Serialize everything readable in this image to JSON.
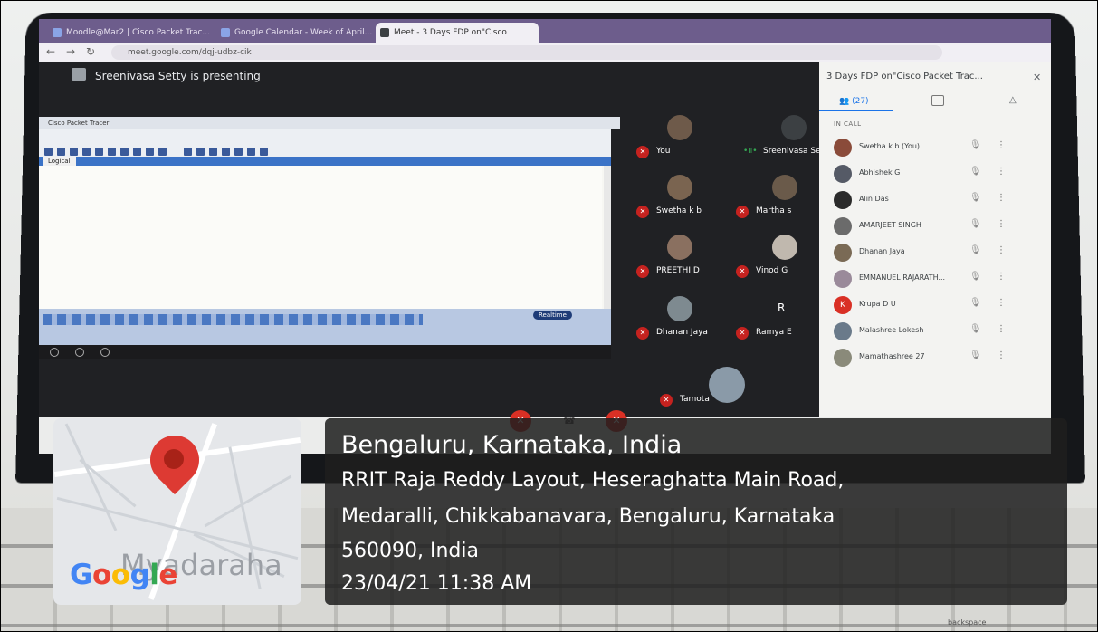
{
  "browser": {
    "tabs": [
      "Moodle@Mar2 | Cisco Packet Trac...",
      "Google Calendar - Week of April...",
      "Meet - 3 Days FDP on\"Cisco"
    ],
    "url": "meet.google.com/dqj-udbz-cik"
  },
  "meet": {
    "presenting_text": "Sreenivasa Setty is presenting",
    "panel_title": "3 Days FDP on\"Cisco Packet Trac...",
    "people_count": "(27)",
    "in_call_label": "IN CALL",
    "participants": [
      {
        "name": "Swetha k b (You)",
        "color": "#8a4b3a"
      },
      {
        "name": "Abhishek G",
        "color": "#555a66"
      },
      {
        "name": "Alin Das",
        "color": "#2b2b2b"
      },
      {
        "name": "AMARJEET SINGH",
        "color": "#6b6b6b"
      },
      {
        "name": "Dhanan Jaya",
        "color": "#7a6a55"
      },
      {
        "name": "EMMANUEL RAJARATH...",
        "color": "#9a8a9a"
      },
      {
        "name": "Krupa D U",
        "color": "#d93025",
        "initial": "K"
      },
      {
        "name": "Malashree Lokesh",
        "color": "#6a7a8a"
      },
      {
        "name": "Mamathashree 27",
        "color": "#8a8a7a"
      }
    ],
    "tiles": [
      {
        "name": "You"
      },
      {
        "name": "Sreenivasa Setty"
      },
      {
        "name": "Swetha k b"
      },
      {
        "name": "Martha s"
      },
      {
        "name": "PREETHI D"
      },
      {
        "name": "Vinod G"
      },
      {
        "name": "Dhanan Jaya"
      },
      {
        "name": "Ramya E",
        "initial": "R"
      },
      {
        "name": "Tamota"
      }
    ],
    "pt_window_title": "Cisco Packet Tracer",
    "pt_tab": "Logical",
    "pt_realtime": "Realtime"
  },
  "location": {
    "city": "Bengaluru, Karnataka, India",
    "address_line1": "RRIT Raja Reddy Layout, Heseraghatta Main Road,",
    "address_line2": "Medaralli, Chikkabanavara, Bengaluru, Karnataka",
    "address_line3": "560090, India",
    "datetime": "23/04/21 11:38 AM",
    "map_place_label": "Myadaraha",
    "map_logo": "Google"
  },
  "keyboard": {
    "backspace_label": "backspace"
  },
  "colors": {
    "mute_red": "#d93025",
    "pin_red": "#dd3a33",
    "meet_bg": "#202124"
  }
}
